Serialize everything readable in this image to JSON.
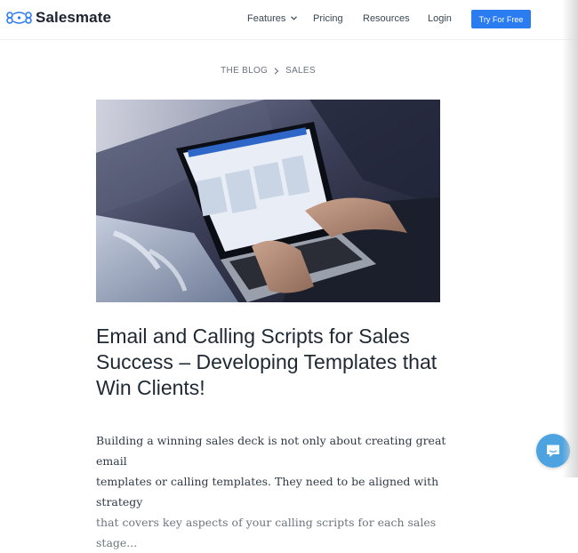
{
  "header": {
    "brand": "Salesmate",
    "nav": [
      {
        "label": "Features"
      },
      {
        "label": "Pricing"
      },
      {
        "label": "Resources"
      },
      {
        "label": "Login"
      }
    ],
    "cta_label": "Try For Free"
  },
  "breadcrumb": {
    "items": [
      "THE BLOG",
      "SALES"
    ]
  },
  "article": {
    "title": "Email and Calling Scripts for Sales Success – Developing Templates that Win Clients!",
    "body_lines": [
      "Building a winning sales deck is not only about creating great email",
      "templates or calling templates. They need to be aligned with strategy",
      "that covers key aspects of your calling scripts for each sales stage..."
    ]
  },
  "colors": {
    "accent": "#2b7cf0",
    "chat": "#4da3e0"
  },
  "icons": {
    "logo": "salesmate-logo-icon",
    "dropdown": "chevron-down-icon",
    "breadcrumb_sep": "chevron-right-icon",
    "chat": "chat-icon"
  }
}
